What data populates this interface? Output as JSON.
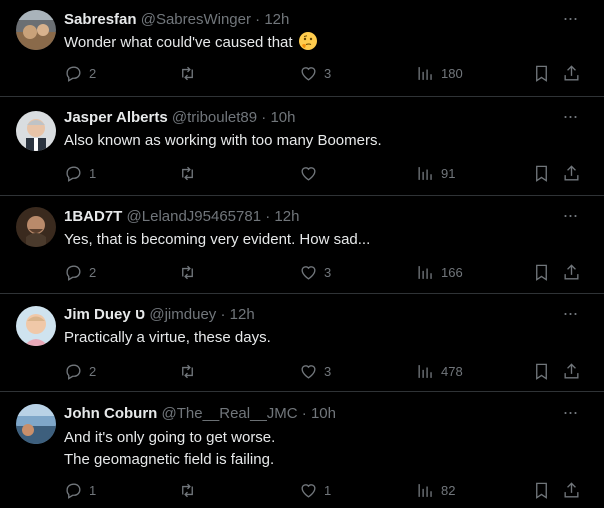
{
  "tweets": [
    {
      "name": "Sabresfan",
      "handle": "@SabresWinger",
      "dot": "·",
      "time": "12h",
      "lines": [
        "Wonder what could've caused that"
      ],
      "has_emoji": true,
      "replies": "2",
      "retweets": "",
      "likes": "3",
      "views": "180"
    },
    {
      "name": "Jasper Alberts",
      "handle": "@triboulet89",
      "dot": "·",
      "time": "10h",
      "lines": [
        "Also known as working with too many Boomers."
      ],
      "replies": "1",
      "retweets": "",
      "likes": "",
      "views": "91"
    },
    {
      "name": "1BAD7T",
      "handle": "@LelandJ95465781",
      "dot": "·",
      "time": "12h",
      "lines": [
        "Yes, that is becoming very evident. How sad..."
      ],
      "replies": "2",
      "retweets": "",
      "likes": "3",
      "views": "166"
    },
    {
      "name": "Jim Duey ט",
      "handle": "@jimduey",
      "dot": "·",
      "time": "12h",
      "lines": [
        "Practically a virtue, these days."
      ],
      "replies": "2",
      "retweets": "",
      "likes": "3",
      "views": "478"
    },
    {
      "name": "John Coburn",
      "handle": "@The__Real__JMC",
      "dot": "·",
      "time": "10h",
      "lines": [
        "And it's only going to get worse.",
        "The geomagnetic field is failing."
      ],
      "replies": "1",
      "retweets": "",
      "likes": "1",
      "views": "82"
    }
  ],
  "more_label": "···",
  "icons": {
    "reply": "reply-icon",
    "retweet": "retweet-icon",
    "like": "heart-icon",
    "views": "views-icon",
    "bookmark": "bookmark-icon",
    "share": "share-icon",
    "more": "more-icon"
  },
  "colors": {
    "background": "#000000",
    "text": "#e7e9ea",
    "muted": "#71767b",
    "divider": "#2f3336"
  }
}
